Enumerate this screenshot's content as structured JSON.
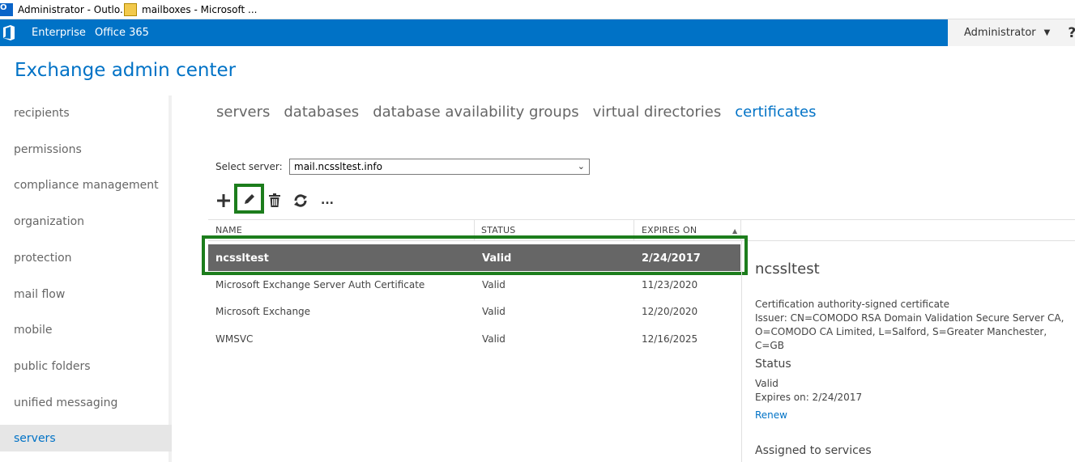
{
  "taskbar": {
    "tabs": [
      {
        "label": "Administrator - Outlo...",
        "icon": "outlook-icon"
      },
      {
        "label": "mailboxes - Microsoft ...",
        "icon": "mail-icon"
      }
    ]
  },
  "header": {
    "nav": [
      "Enterprise",
      "Office 365"
    ],
    "user": "Administrator",
    "help": "?"
  },
  "app": {
    "title": "Exchange admin center"
  },
  "sidebar": {
    "items": [
      {
        "label": "recipients"
      },
      {
        "label": "permissions"
      },
      {
        "label": "compliance management"
      },
      {
        "label": "organization"
      },
      {
        "label": "protection"
      },
      {
        "label": "mail flow"
      },
      {
        "label": "mobile"
      },
      {
        "label": "public folders"
      },
      {
        "label": "unified messaging"
      },
      {
        "label": "servers"
      }
    ],
    "active": "servers"
  },
  "subtabs": {
    "items": [
      "servers",
      "databases",
      "database availability groups",
      "virtual directories",
      "certificates"
    ],
    "active": "certificates"
  },
  "server_select": {
    "label": "Select server:",
    "value": "mail.ncssltest.info"
  },
  "toolbar": {
    "icons": [
      "add-icon",
      "edit-icon",
      "delete-icon",
      "refresh-icon",
      "more-icon"
    ],
    "more_label": "...",
    "highlight_color": "#1c7d1c"
  },
  "table": {
    "columns": [
      "NAME",
      "STATUS",
      "EXPIRES ON"
    ],
    "rows": [
      {
        "name": "ncssltest",
        "status": "Valid",
        "expires": "2/24/2017"
      },
      {
        "name": "Microsoft Exchange Server Auth Certificate",
        "status": "Valid",
        "expires": "11/23/2020"
      },
      {
        "name": "Microsoft Exchange",
        "status": "Valid",
        "expires": "12/20/2020"
      },
      {
        "name": "WMSVC",
        "status": "Valid",
        "expires": "12/16/2025"
      }
    ]
  },
  "details": {
    "name": "ncssltest",
    "type": "Certification authority-signed certificate",
    "issuer_line1": "Issuer: CN=COMODO RSA Domain Validation Secure Server CA,",
    "issuer_line2": "O=COMODO CA Limited, L=Salford, S=Greater Manchester, C=GB",
    "status_heading": "Status",
    "status_value": "Valid",
    "expires": "Expires on: 2/24/2017",
    "renew": "Renew",
    "services_heading": "Assigned to services"
  },
  "colors": {
    "brand": "#0072c6",
    "selected_row": "#666666",
    "highlight": "#1c7d1c"
  }
}
